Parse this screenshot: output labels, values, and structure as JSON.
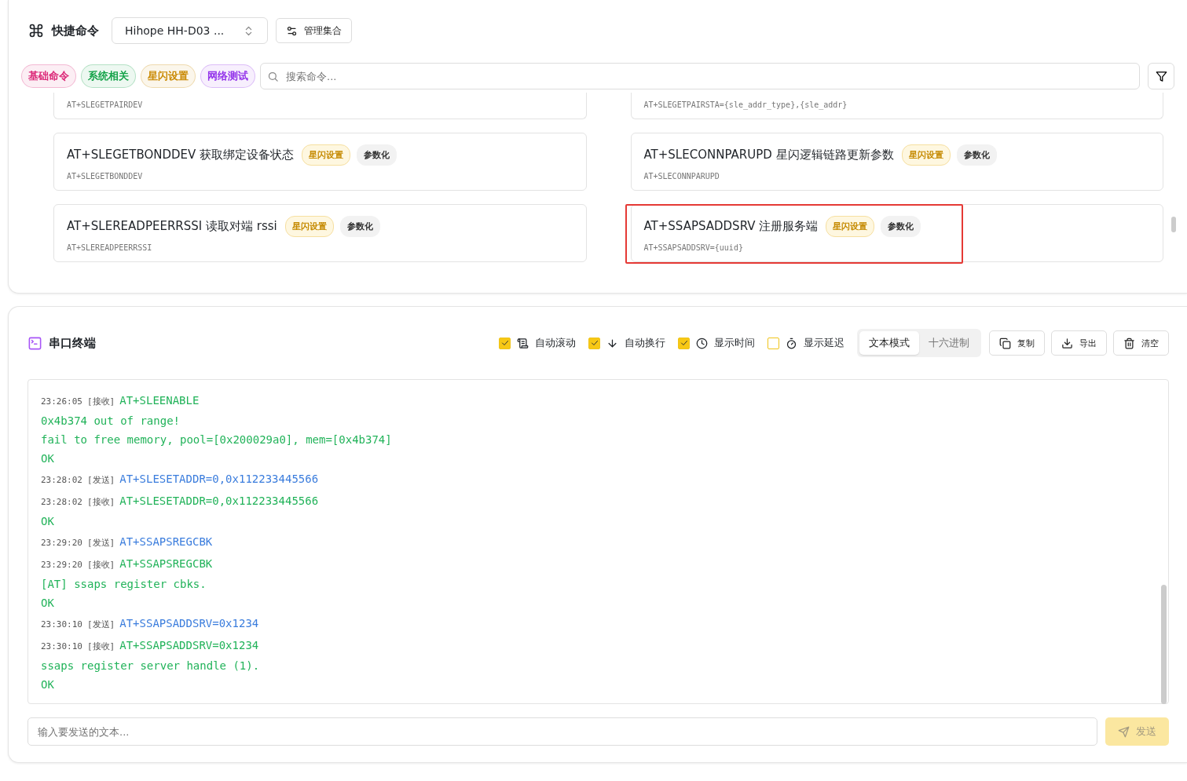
{
  "quick_commands": {
    "title": "快捷命令",
    "device_select": {
      "value": "Hihope HH-D03 ..."
    },
    "manage_button": "管理集合",
    "category_tags": [
      {
        "label": "基础命令",
        "color": "#db2777"
      },
      {
        "label": "系统相关",
        "color": "#16a34a"
      },
      {
        "label": "星闪设置",
        "color": "#ca8a04"
      },
      {
        "label": "网络测试",
        "color": "#9333ea"
      }
    ],
    "search": {
      "placeholder": "搜索命令..."
    },
    "commands": [
      {
        "code": "AT+SLEGETPAIRDEV"
      },
      {
        "code": "AT+SLEGETPAIRSTA={sle_addr_type},{sle_addr}"
      },
      {
        "title": "AT+SLEGETBONDDEV 获取绑定设备状态",
        "tags": [
          "星闪设置",
          "参数化"
        ],
        "code": "AT+SLEGETBONDDEV",
        "highlighted": false
      },
      {
        "title": "AT+SLECONNPARUPD 星闪逻辑链路更新参数",
        "tags": [
          "星闪设置",
          "参数化"
        ],
        "code": "AT+SLECONNPARUPD",
        "highlighted": false
      },
      {
        "title": "AT+SLEREADPEERRSSI 读取对端 rssi",
        "tags": [
          "星闪设置",
          "参数化"
        ],
        "code": "AT+SLEREADPEERRSSI",
        "highlighted": false
      },
      {
        "title": "AT+SSAPSADDSRV 注册服务端",
        "tags": [
          "星闪设置",
          "参数化"
        ],
        "code": "AT+SSAPSADDSRV={uuid}",
        "highlighted": true
      }
    ]
  },
  "terminal": {
    "title": "串口终端",
    "options": [
      {
        "label": "自动滚动",
        "checked": true
      },
      {
        "label": "自动换行",
        "checked": true
      },
      {
        "label": "显示时间",
        "checked": true
      },
      {
        "label": "显示延迟",
        "checked": false
      }
    ],
    "modes": [
      {
        "label": "文本模式",
        "selected": true
      },
      {
        "label": "十六进制",
        "selected": false
      }
    ],
    "actions": [
      {
        "label": "复制"
      },
      {
        "label": "导出"
      },
      {
        "label": "清空"
      }
    ],
    "log": [
      {
        "kind": "rx",
        "time": "23:26:05",
        "dir": "[接收]",
        "text": "AT+SLEENABLE"
      },
      {
        "kind": "out",
        "text": "0x4b374 out of range!"
      },
      {
        "kind": "out",
        "text": "fail to free memory, pool=[0x200029a0], mem=[0x4b374]"
      },
      {
        "kind": "out",
        "text": "OK"
      },
      {
        "kind": "tx",
        "time": "23:28:02",
        "dir": "[发送]",
        "text": "AT+SLESETADDR=0,0x112233445566"
      },
      {
        "kind": "rx",
        "time": "23:28:02",
        "dir": "[接收]",
        "text": "AT+SLESETADDR=0,0x112233445566"
      },
      {
        "kind": "out",
        "text": "OK"
      },
      {
        "kind": "tx",
        "time": "23:29:20",
        "dir": "[发送]",
        "text": "AT+SSAPSREGCBK"
      },
      {
        "kind": "rx",
        "time": "23:29:20",
        "dir": "[接收]",
        "text": "AT+SSAPSREGCBK"
      },
      {
        "kind": "out",
        "text": "[AT] ssaps register cbks."
      },
      {
        "kind": "out",
        "text": "OK"
      },
      {
        "kind": "tx",
        "time": "23:30:10",
        "dir": "[发送]",
        "text": "AT+SSAPSADDSRV=0x1234"
      },
      {
        "kind": "rx",
        "time": "23:30:10",
        "dir": "[接收]",
        "text": "AT+SSAPSADDSRV=0x1234"
      },
      {
        "kind": "out",
        "text": "ssaps register server handle (1)."
      },
      {
        "kind": "out",
        "text": "OK"
      }
    ],
    "input": {
      "placeholder": "输入要发送的文本..."
    },
    "send_button": {
      "label": "发送",
      "disabled": true
    }
  }
}
